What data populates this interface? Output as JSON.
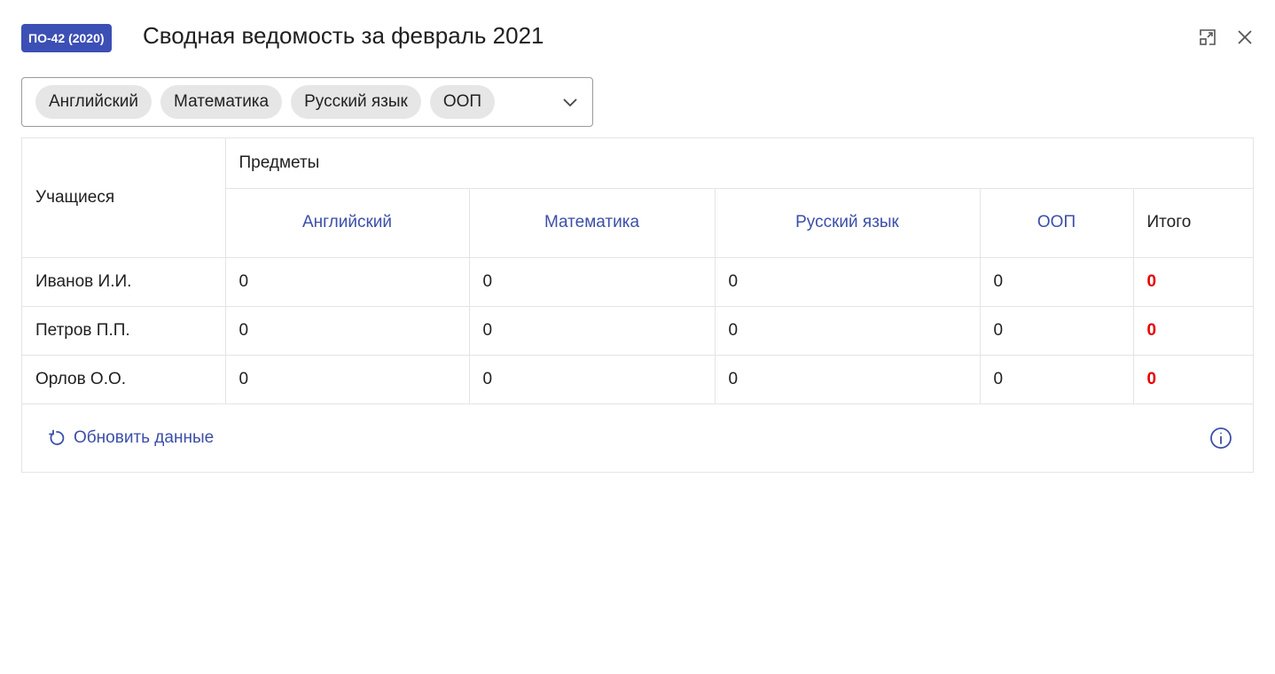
{
  "header": {
    "group_badge": "ПО-42 (2020)",
    "title": "Сводная ведомость за февраль 2021",
    "expand_icon": "expand-icon",
    "close_icon": "close-icon"
  },
  "filter": {
    "chips": [
      "Английский",
      "Математика",
      "Русский язык",
      "ООП"
    ],
    "dropdown_icon": "chevron-down-icon"
  },
  "table": {
    "students_header": "Учащиеся",
    "subjects_header": "Предметы",
    "columns": [
      "Английский",
      "Математика",
      "Русский язык",
      "ООП"
    ],
    "total_header": "Итого",
    "rows": [
      {
        "name": "Иванов И.И.",
        "values": [
          "0",
          "0",
          "0",
          "0"
        ],
        "total": "0"
      },
      {
        "name": "Петров П.П.",
        "values": [
          "0",
          "0",
          "0",
          "0"
        ],
        "total": "0"
      },
      {
        "name": "Орлов О.О.",
        "values": [
          "0",
          "0",
          "0",
          "0"
        ],
        "total": "0"
      }
    ]
  },
  "footer": {
    "refresh_label": "Обновить данные",
    "refresh_icon": "refresh-icon",
    "info_icon": "info-icon"
  },
  "colors": {
    "accent": "#3c4fa8",
    "badge_bg": "#3c4fb5",
    "total_value": "#e60000",
    "chip_bg": "#e6e6e6"
  }
}
